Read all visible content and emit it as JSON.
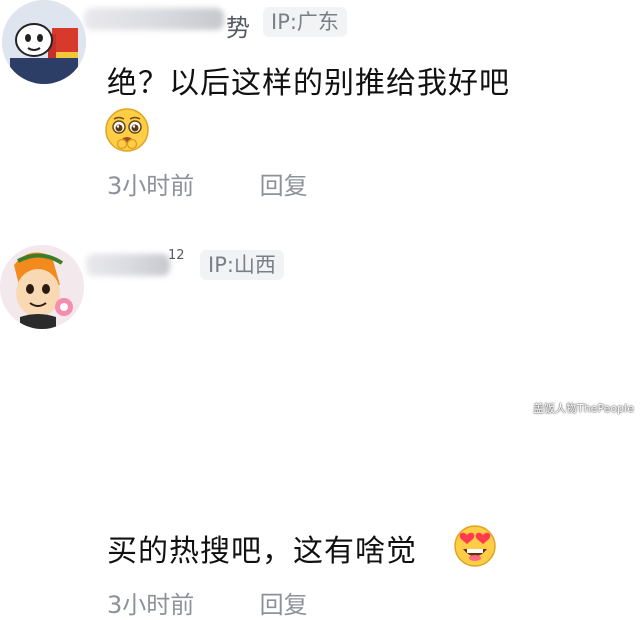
{
  "comments": [
    {
      "username_visible": "势",
      "ip": "IP:广东",
      "text": "绝？以后这样的别推给我好吧",
      "time": "3小时前",
      "reply_label": "回复",
      "emoji_icon": "pleading-face-emoji"
    },
    {
      "username_visible": "12",
      "ip": "IP:山西",
      "text": "买的热搜吧，这有啥觉",
      "time": "3小时前",
      "reply_label": "回复",
      "emoji_icon": "heart-eyes-face-emoji"
    }
  ],
  "watermark": "盖饭人物ThePeople"
}
